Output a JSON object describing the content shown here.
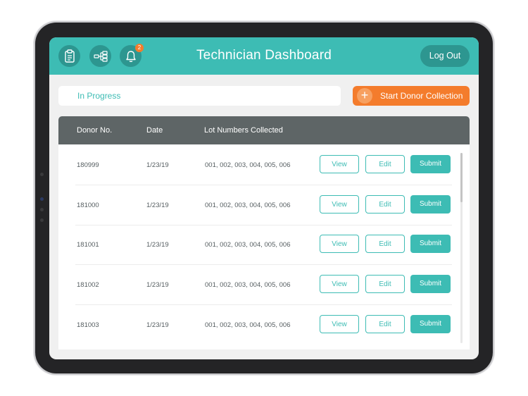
{
  "header": {
    "title": "Technician Dashboard",
    "logout_label": "Log Out",
    "notification_count": "2",
    "icons": [
      "clipboard-icon",
      "hierarchy-icon",
      "bell-icon"
    ]
  },
  "status": {
    "label": "In Progress"
  },
  "actions": {
    "start_label": "Start Donor Collection"
  },
  "table": {
    "columns": [
      "Donor No.",
      "Date",
      "Lot Numbers Collected"
    ],
    "buttons": {
      "view": "View",
      "edit": "Edit",
      "submit": "Submit"
    },
    "rows": [
      {
        "donor": "180999",
        "date": "1/23/19",
        "lots": "001, 002, 003, 004, 005, 006"
      },
      {
        "donor": "181000",
        "date": "1/23/19",
        "lots": "001, 002, 003, 004, 005, 006"
      },
      {
        "donor": "181001",
        "date": "1/23/19",
        "lots": "001, 002, 003, 004, 005, 006"
      },
      {
        "donor": "181002",
        "date": "1/23/19",
        "lots": "001, 002, 003, 004, 005, 006"
      },
      {
        "donor": "181003",
        "date": "1/23/19",
        "lots": "001, 002, 003, 004, 005, 006"
      }
    ]
  },
  "colors": {
    "teal": "#3dbcb4",
    "teal_dark": "#2d9690",
    "orange": "#f47c2c",
    "table_header": "#5e6566",
    "background": "#f0f0f0"
  }
}
